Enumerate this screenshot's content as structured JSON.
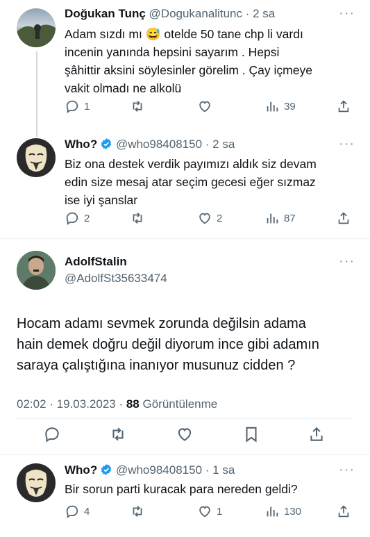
{
  "tweets": [
    {
      "name": "Doğukan Tunç",
      "handle": "@Dogukanalitunc",
      "time": "· 2 sa",
      "line1": "Adam sızdı mı",
      "emoji": "😅",
      "line1b": "otelde 50 tane chp li vardı",
      "line2": "incenin yanında hepsini  sayarım . Hepsi",
      "line3": "şâhittir aksini söylesinler görelim . Çay içmeye",
      "line4": "vakit olmadı ne alkolü",
      "replies": "1",
      "likes": "",
      "views": "39"
    },
    {
      "name": "Who?",
      "handle": "@who98408150",
      "time": "· 2 sa",
      "line1": "Biz ona destek verdik payımızı aldık siz devam",
      "line2": "edin size mesaj atar seçim gecesi eğer sızmaz",
      "line3": "ise iyi şanslar",
      "replies": "2",
      "likes": "2",
      "views": "87"
    }
  ],
  "main": {
    "name": "AdolfStalin",
    "handle": "@AdolfSt35633474",
    "line1": "Hocam adamı sevmek zorunda değilsin adama",
    "line2": "hain demek doğru değil diyorum ince gibi adamın",
    "line3": "saraya çalıştığına inanıyor musunuz cidden ?",
    "timestamp": "02:02 · 19.03.2023 · ",
    "views_count": "88",
    "views_label": "Görüntülenme"
  },
  "reply": {
    "name": "Who?",
    "handle": "@who98408150",
    "time": "· 1 sa",
    "line1": "Bir sorun parti kuracak para nereden geldi?",
    "replies": "4",
    "likes": "1",
    "views": "130"
  },
  "colors": {
    "text": "#0f1419",
    "muted": "#536471",
    "verified": "#1d9bf0",
    "divider": "#eff3f4",
    "thread": "#cfd9de"
  }
}
